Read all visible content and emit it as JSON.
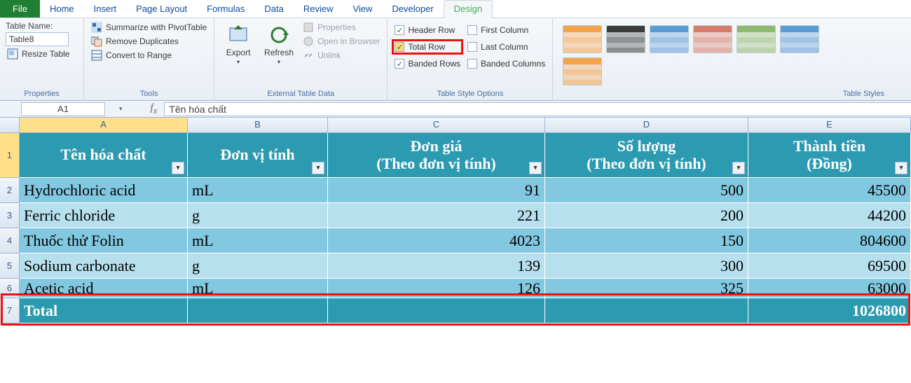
{
  "tabs": {
    "file": "File",
    "items": [
      "Home",
      "Insert",
      "Page Layout",
      "Formulas",
      "Data",
      "Review",
      "View",
      "Developer",
      "Design"
    ],
    "active": "Design"
  },
  "ribbon": {
    "properties": {
      "label": "Properties",
      "table_name_label": "Table Name:",
      "table_name_value": "Table8",
      "resize": "Resize Table"
    },
    "tools": {
      "label": "Tools",
      "pivot": "Summarize with PivotTable",
      "dup": "Remove Duplicates",
      "range": "Convert to Range"
    },
    "ext": {
      "label": "External Table Data",
      "export": "Export",
      "refresh": "Refresh",
      "props": "Properties",
      "browser": "Open in Browser",
      "unlink": "Unlink"
    },
    "opts": {
      "label": "Table Style Options",
      "header": "Header Row",
      "total": "Total Row",
      "banded_r": "Banded Rows",
      "first": "First Column",
      "last": "Last Column",
      "banded_c": "Banded Columns"
    },
    "styles": {
      "label": "Table Styles"
    }
  },
  "namebox": "A1",
  "fx_value": "Tên hóa chất",
  "columns": [
    "A",
    "B",
    "C",
    "D",
    "E"
  ],
  "headers": {
    "A": "Tên hóa chất",
    "B": "Đơn vị tính",
    "C": "Đơn giá\n(Theo đơn vị tính)",
    "D": "Số lượng\n(Theo đơn vị tính)",
    "E": "Thành tiền\n(Đồng)"
  },
  "data_rows": [
    {
      "n": "2",
      "a": "Hydrochloric acid",
      "b": "mL",
      "c": "91",
      "d": "500",
      "e": "45500"
    },
    {
      "n": "3",
      "a": "Ferric chloride",
      "b": "g",
      "c": "221",
      "d": "200",
      "e": "44200"
    },
    {
      "n": "4",
      "a": "Thuốc thử Folin",
      "b": "mL",
      "c": "4023",
      "d": "150",
      "e": "804600"
    },
    {
      "n": "5",
      "a": "Sodium carbonate",
      "b": "g",
      "c": "139",
      "d": "300",
      "e": "69500"
    },
    {
      "n": "6",
      "a": "Acetic acid",
      "b": "mL",
      "c": "126",
      "d": "325",
      "e": "63000"
    }
  ],
  "total_row": {
    "n": "7",
    "label": "Total",
    "value": "1026800"
  },
  "swatches": [
    "#f5a34a",
    "#3b3b3b",
    "#5a9bd5",
    "#d87b6a",
    "#8fb96e",
    "#5a9bd5",
    "#f5a34a"
  ]
}
